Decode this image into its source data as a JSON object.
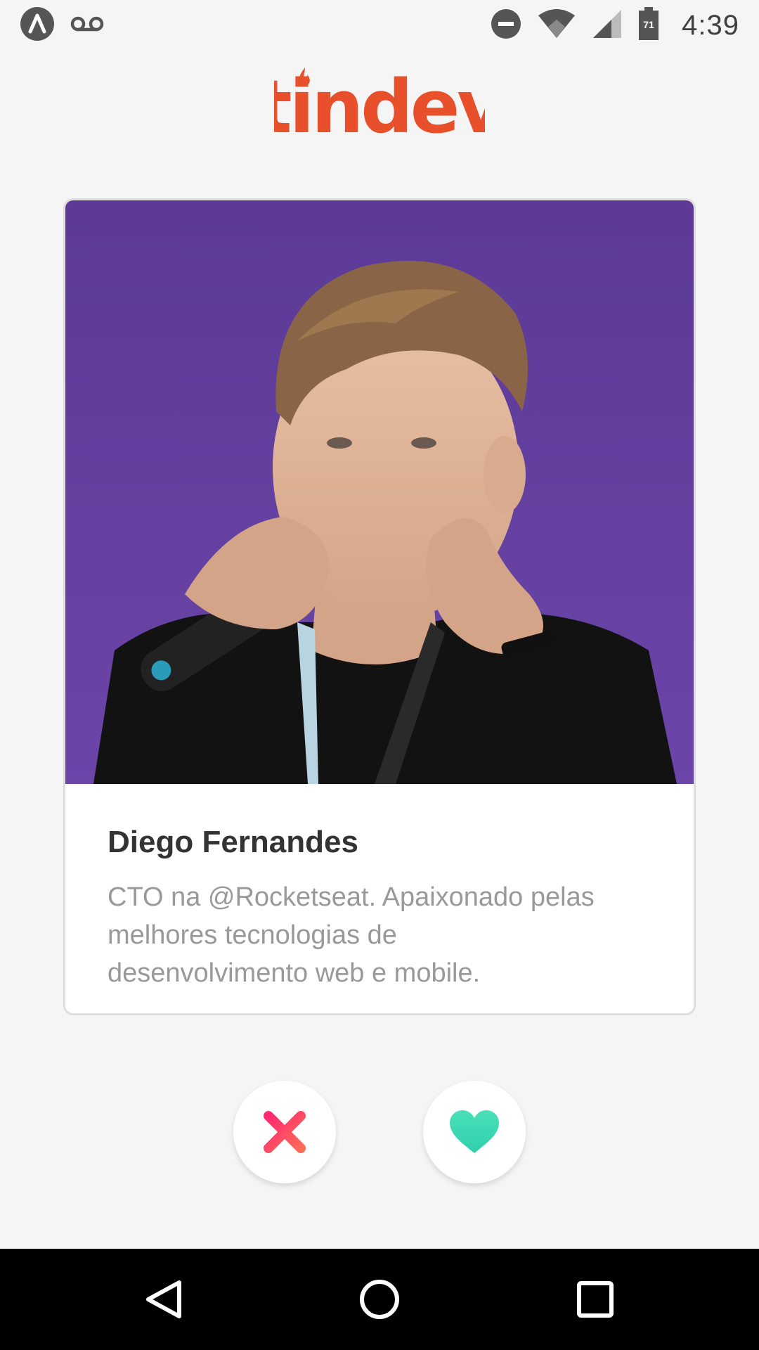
{
  "status_bar": {
    "time": "4:39",
    "battery_level": "71",
    "left_icons": [
      "app-notification-icon",
      "voicemail-icon"
    ],
    "right_icons": [
      "do-not-disturb-icon",
      "wifi-icon",
      "cell-signal-icon",
      "battery-icon"
    ]
  },
  "header": {
    "logo_text": "tindev",
    "logo_icon": "flame-icon",
    "brand_color": "#e84f2b"
  },
  "card": {
    "name": "Diego Fernandes",
    "bio": "CTO na @Rocketseat. Apaixonado pelas melhores tecnologias de desenvolvimento web e mobile.",
    "photo_icon": "user-photo"
  },
  "actions": {
    "dislike_icon": "close-icon",
    "like_icon": "heart-icon",
    "dislike_color": "#fd3a73",
    "like_color": "#3dd5b0"
  },
  "nav_bar": {
    "back_icon": "back-triangle-icon",
    "home_icon": "home-circle-icon",
    "recents_icon": "recents-square-icon"
  }
}
